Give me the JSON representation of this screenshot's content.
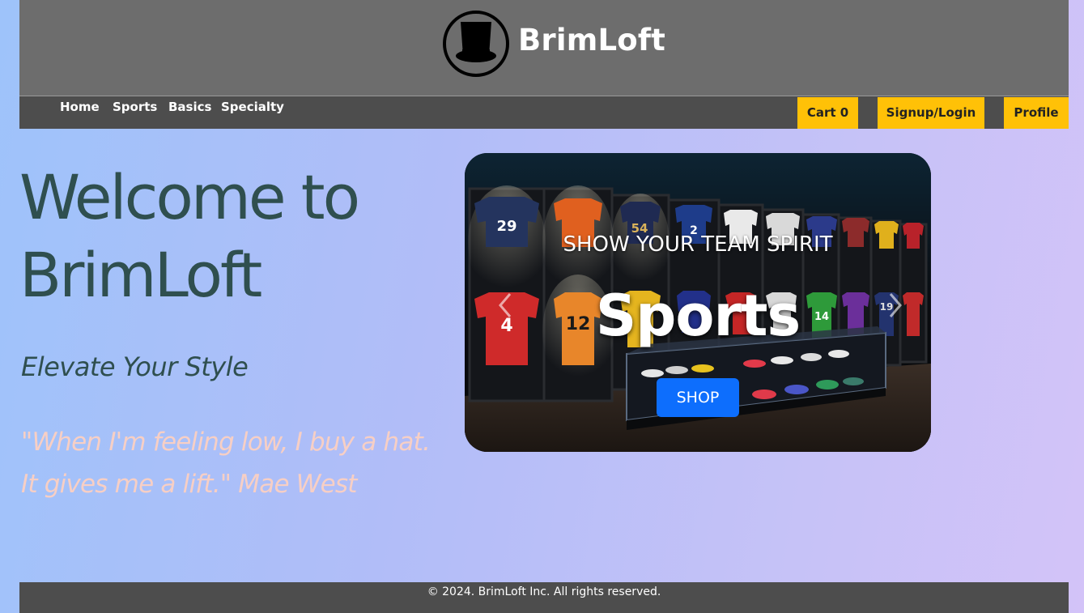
{
  "header": {
    "brand": "BrimLoft",
    "logo_icon": "top-hat-icon"
  },
  "nav": {
    "links": [
      {
        "label": "Home"
      },
      {
        "label": "Sports"
      },
      {
        "label": "Basics"
      },
      {
        "label": "Specialty"
      }
    ],
    "cart_label": "Cart 0",
    "signup_label": "Signup/Login",
    "profile_label": "Profile",
    "accent_color": "#ffc107"
  },
  "hero": {
    "title_line1": "Welcome to",
    "title_line2": "BrimLoft",
    "tagline": "Elevate Your Style",
    "quote_line1": "\"When I'm feeling low, I buy a hat.",
    "quote_line2": "It gives me a lift.\" Mae West"
  },
  "carousel": {
    "subtitle": "SHOW YOUR TEAM SPIRIT",
    "title": "Sports",
    "button_label": "SHOP",
    "button_color": "#0d6efd",
    "image_subject": "sports jersey store display",
    "jersey_numbers": [
      "29",
      "54",
      "2",
      "4",
      "12",
      "14",
      "19"
    ]
  },
  "footer": {
    "copyright": "© 2024. BrimLoft Inc. All rights reserved."
  }
}
